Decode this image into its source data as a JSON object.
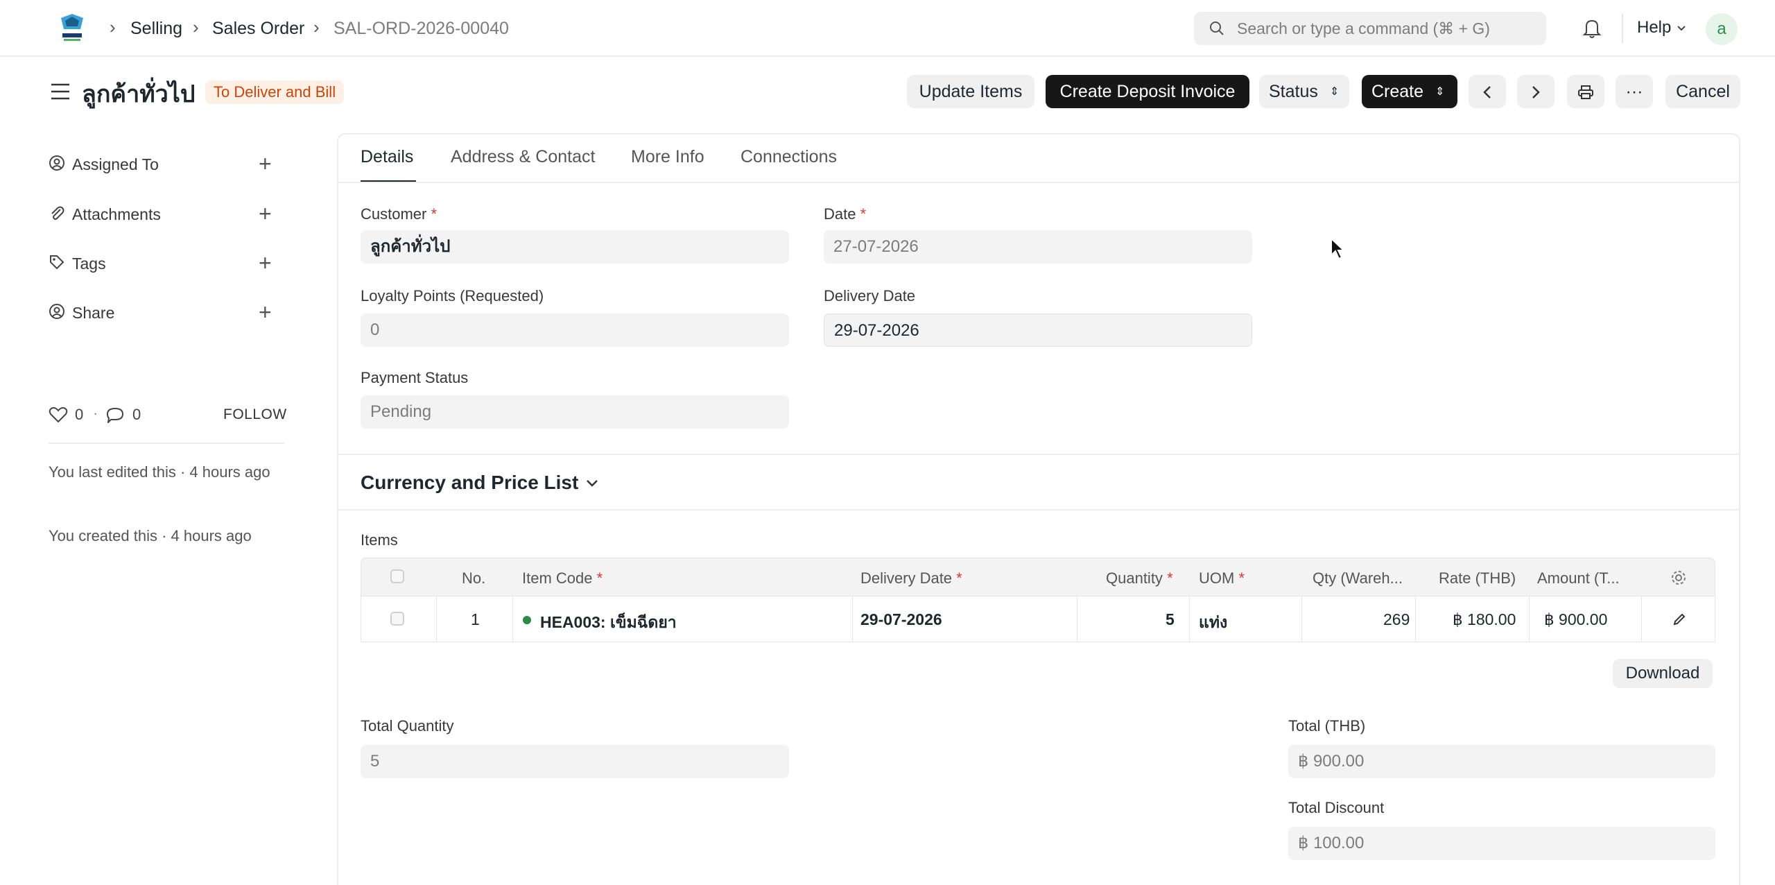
{
  "navbar": {
    "breadcrumbs": [
      "Selling",
      "Sales Order",
      "SAL-ORD-2026-00040"
    ],
    "search_placeholder": "Search or type a command (⌘ + G)",
    "help_label": "Help",
    "avatar_letter": "a"
  },
  "page": {
    "title": "ลูกค้าทั่วไป",
    "status_badge": "To Deliver and Bill",
    "status_badge_color": "#c9450a",
    "actions": {
      "update_items": "Update Items",
      "create_deposit_invoice": "Create Deposit Invoice",
      "status": "Status",
      "create": "Create",
      "more": "···",
      "cancel": "Cancel"
    }
  },
  "sidebar": {
    "items": [
      {
        "label": "Assigned To",
        "icon": "assign-icon"
      },
      {
        "label": "Attachments",
        "icon": "paperclip-icon"
      },
      {
        "label": "Tags",
        "icon": "tag-icon"
      },
      {
        "label": "Share",
        "icon": "share-icon"
      }
    ],
    "likes": "0",
    "comments": "0",
    "follow_label": "FOLLOW",
    "last_edited": "You last edited this · 4 hours ago",
    "created": "You created this · 4 hours ago"
  },
  "tabs": [
    "Details",
    "Address & Contact",
    "More Info",
    "Connections"
  ],
  "form": {
    "customer_label": "Customer",
    "customer_value": "ลูกค้าทั่วไป",
    "date_label": "Date",
    "date_value": "27-07-2026",
    "loyalty_label": "Loyalty Points (Requested)",
    "loyalty_value": "0",
    "delivery_label": "Delivery Date",
    "delivery_value": "29-07-2026",
    "payment_label": "Payment Status",
    "payment_value": "Pending"
  },
  "currency_section_title": "Currency and Price List",
  "items_table": {
    "label": "Items",
    "columns": [
      "No.",
      "Item Code",
      "Delivery Date",
      "Quantity",
      "UOM",
      "Qty (Wareh...",
      "Rate (THB)",
      "Amount (T..."
    ],
    "rows": [
      {
        "no": "1",
        "item_code": "HEA003: เข็มฉีดยา",
        "delivery_date": "29-07-2026",
        "quantity": "5",
        "uom": "แท่ง",
        "qty_wh": "269",
        "rate": "฿ 180.00",
        "amount": "฿ 900.00"
      }
    ],
    "download_label": "Download"
  },
  "totals": {
    "total_qty_label": "Total Quantity",
    "total_qty_value": "5",
    "total_label": "Total (THB)",
    "total_value": "฿ 900.00",
    "discount_label": "Total Discount",
    "discount_value": "฿ 100.00"
  }
}
